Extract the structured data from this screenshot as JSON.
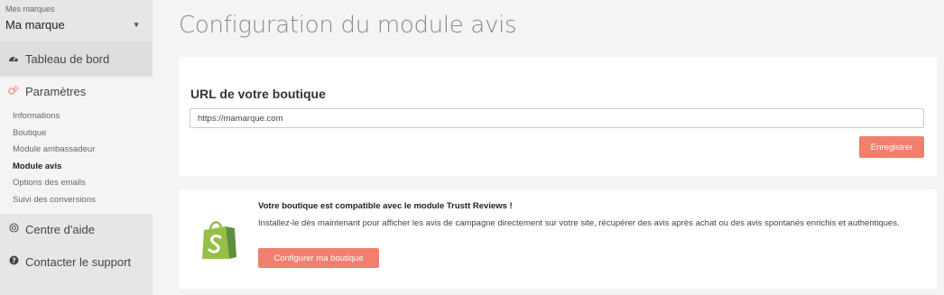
{
  "sidebar": {
    "brand_caption": "Mes marques",
    "brand_selected": "Ma marque",
    "dashboard_label": "Tableau de bord",
    "settings_label": "Paramètres",
    "sub_items": [
      {
        "label": "Informations"
      },
      {
        "label": "Boutique"
      },
      {
        "label": "Module ambassadeur"
      },
      {
        "label": "Module avis"
      },
      {
        "label": "Options des emails"
      },
      {
        "label": "Suivi des conversions"
      }
    ],
    "current_sub_item": "Module avis",
    "help_label": "Centre d'aide",
    "support_label": "Contacter le support"
  },
  "main": {
    "title": "Configuration du module avis",
    "url_section": {
      "heading": "URL de votre boutique",
      "input_value": "https://mamarque.com",
      "save_label": "Enregistrer"
    },
    "promo": {
      "title": "Votre boutique est compatible avec le module Trustt Reviews !",
      "text": "Installez-le dès maintenant pour afficher les avis de campagne directement sur votre site, récupérer des avis après achat ou des avis spontanés enrichis et authentiques.",
      "button_label": "Configurer ma boutique"
    }
  },
  "colors": {
    "accent": "#f07f6d",
    "shopify_green": "#95bf47",
    "shopify_dark_green": "#5e8e3e"
  },
  "icons": {
    "dashboard": "dashboard-icon",
    "settings": "gears-icon",
    "help": "lifebuoy-icon",
    "support": "question-circle-icon",
    "caret": "caret-down-icon",
    "shop": "shopify-bag-icon"
  }
}
